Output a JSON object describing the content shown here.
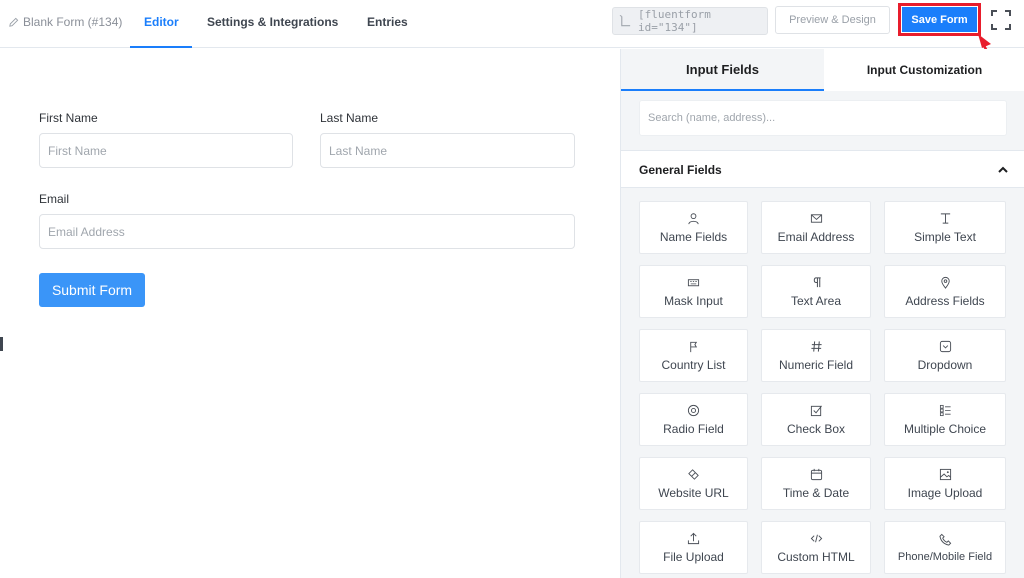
{
  "topbar": {
    "breadcrumb": "Blank Form (#134)",
    "tabs": [
      "Editor",
      "Settings & Integrations",
      "Entries"
    ],
    "shortcode": "[fluentform id=\"134\"]",
    "preview_label": "Preview & Design",
    "save_label": "Save Form"
  },
  "form": {
    "first_name_label": "First Name",
    "first_name_placeholder": "First Name",
    "last_name_label": "Last Name",
    "last_name_placeholder": "Last Name",
    "email_label": "Email",
    "email_placeholder": "Email Address",
    "submit_label": "Submit Form"
  },
  "panel": {
    "tabs": [
      "Input Fields",
      "Input Customization"
    ],
    "search_placeholder": "Search (name, address)...",
    "section_title": "General Fields",
    "fields": [
      {
        "label": "Name Fields",
        "icon": "user-icon"
      },
      {
        "label": "Email Address",
        "icon": "envelope-icon"
      },
      {
        "label": "Simple Text",
        "icon": "text-cursor-icon"
      },
      {
        "label": "Mask Input",
        "icon": "keyboard-icon"
      },
      {
        "label": "Text Area",
        "icon": "paragraph-icon"
      },
      {
        "label": "Address Fields",
        "icon": "map-pin-icon"
      },
      {
        "label": "Country List",
        "icon": "flag-icon"
      },
      {
        "label": "Numeric Field",
        "icon": "hash-icon"
      },
      {
        "label": "Dropdown",
        "icon": "dropdown-icon"
      },
      {
        "label": "Radio Field",
        "icon": "radio-icon"
      },
      {
        "label": "Check Box",
        "icon": "checkbox-icon"
      },
      {
        "label": "Multiple Choice",
        "icon": "list-icon"
      },
      {
        "label": "Website URL",
        "icon": "link-icon"
      },
      {
        "label": "Time & Date",
        "icon": "calendar-icon"
      },
      {
        "label": "Image Upload",
        "icon": "image-icon"
      },
      {
        "label": "File Upload",
        "icon": "upload-icon"
      },
      {
        "label": "Custom HTML",
        "icon": "code-icon"
      },
      {
        "label": "Phone/Mobile Field",
        "icon": "phone-icon"
      }
    ]
  },
  "colors": {
    "accent": "#1a7efb",
    "highlight": "#e81d2c",
    "submit": "#3a95f8"
  }
}
